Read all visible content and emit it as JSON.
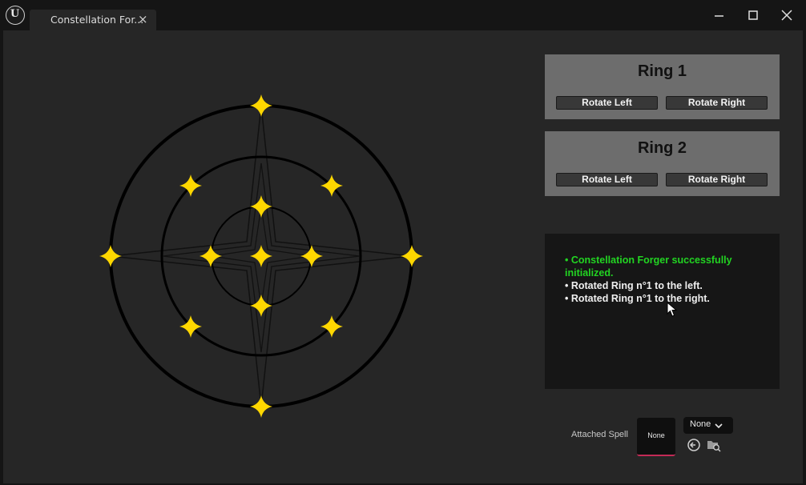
{
  "window": {
    "tab_label": "Constellation For...",
    "tab_close": "×",
    "logo_glyph": "U",
    "controls": [
      "minimize-icon",
      "maximize-icon",
      "close-icon"
    ]
  },
  "rings": [
    {
      "title": "Ring 1",
      "rotate_left": "Rotate Left",
      "rotate_right": "Rotate Right"
    },
    {
      "title": "Ring 2",
      "rotate_left": "Rotate Left",
      "rotate_right": "Rotate Right"
    }
  ],
  "log": {
    "lines": [
      {
        "text": "• Constellation Forger successfully initialized.",
        "color": "#22d422"
      },
      {
        "text": "• Rotated Ring n°1 to the left.",
        "color": "#f0f0f0"
      },
      {
        "text": "• Rotated Ring n°1 to the right.",
        "color": "#f0f0f0"
      }
    ]
  },
  "attached_spell": {
    "label": "Attached Spell",
    "slot_value": "None",
    "dropdown_value": "None",
    "icons": [
      "use-selected-icon",
      "browse-folder-icon"
    ]
  },
  "colors": {
    "star": "#ffd700",
    "panel_gray": "#6d6d6d",
    "slot_accent": "#c32a56",
    "log_success": "#22d422"
  }
}
